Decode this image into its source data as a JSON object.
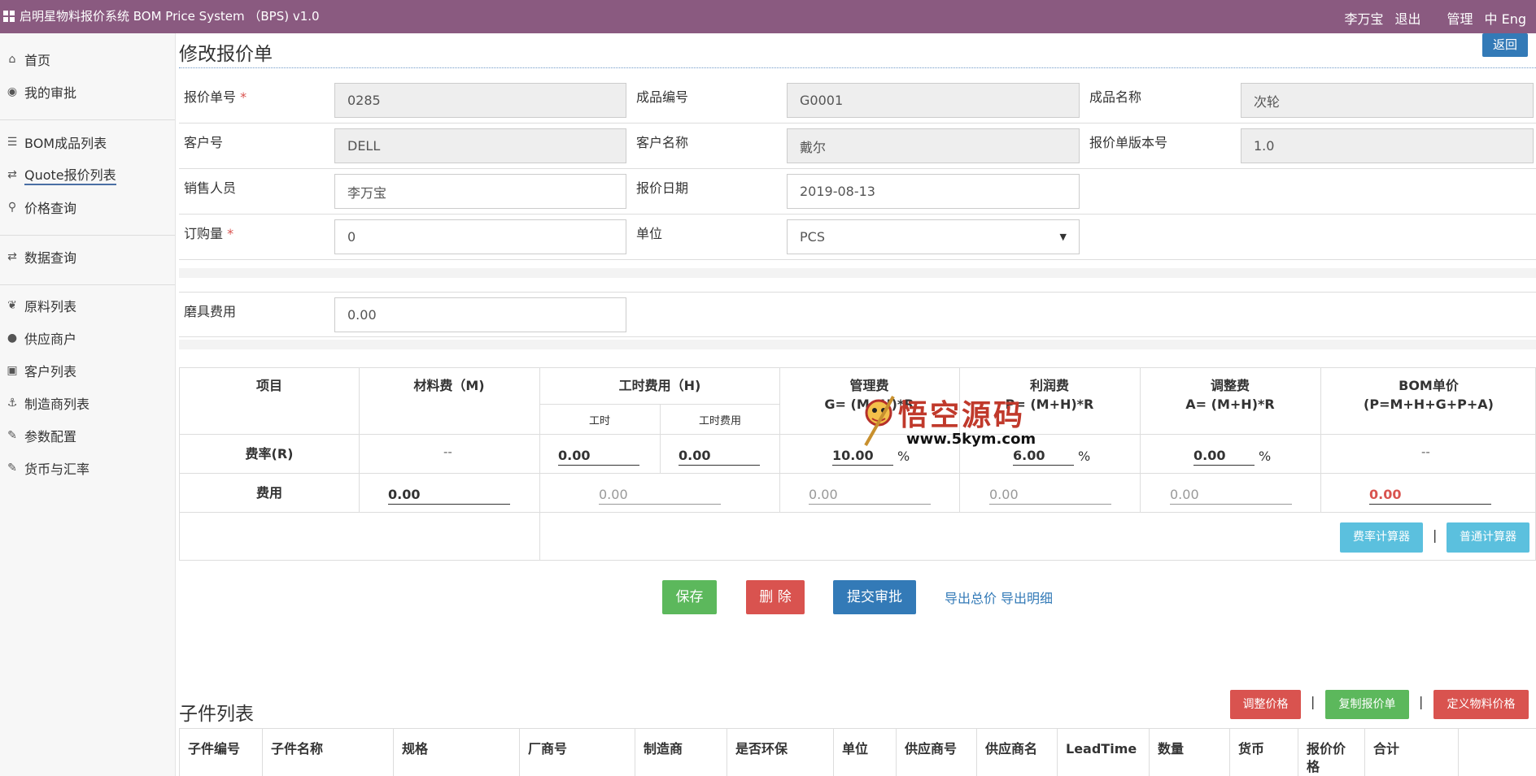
{
  "app": {
    "title": "启明星物料报价系统 BOM Price System （BPS) v1.0"
  },
  "topbar": {
    "user": "李万宝",
    "logout": "退出",
    "admin": "管理",
    "lang": "中 Eng"
  },
  "sidebar": {
    "items": [
      {
        "label": "首页",
        "icon": "home-icon"
      },
      {
        "label": "我的审批",
        "icon": "comment-icon"
      },
      {
        "label": "BOM成品列表",
        "icon": "list-icon"
      },
      {
        "label": "Quote报价列表",
        "icon": "retweet-icon"
      },
      {
        "label": "价格查询",
        "icon": "search-icon"
      },
      {
        "label": "数据查询",
        "icon": "retweet-icon"
      },
      {
        "label": "原料列表",
        "icon": "leaf-icon"
      },
      {
        "label": "供应商户",
        "icon": "user-icon"
      },
      {
        "label": "客户列表",
        "icon": "contact-icon"
      },
      {
        "label": "制造商列表",
        "icon": "anchor-icon"
      },
      {
        "label": "参数配置",
        "icon": "wrench-icon"
      },
      {
        "label": "货币与汇率",
        "icon": "wrench-icon"
      }
    ]
  },
  "page": {
    "title": "修改报价单",
    "back": "返回"
  },
  "form": {
    "quote_no": {
      "label": "报价单号",
      "value": "0285"
    },
    "product_no": {
      "label": "成品编号",
      "value": "G0001"
    },
    "product_name": {
      "label": "成品名称",
      "value": "次轮"
    },
    "customer_no": {
      "label": "客户号",
      "value": "DELL"
    },
    "customer_name": {
      "label": "客户名称",
      "value": "戴尔"
    },
    "version": {
      "label": "报价单版本号",
      "value": "1.0"
    },
    "sales": {
      "label": "销售人员",
      "value": "李万宝"
    },
    "quote_date": {
      "label": "报价日期",
      "value": "2019-08-13"
    },
    "order_qty": {
      "label": "订购量",
      "value": "0"
    },
    "unit": {
      "label": "单位",
      "value": "PCS"
    },
    "tooling": {
      "label": "磨具费用",
      "value": "0.00"
    }
  },
  "cost": {
    "headers": {
      "item": "项目",
      "material": "材料费（M)",
      "labor": "工时费用（H)",
      "labor_hours": "工时",
      "labor_fee": "工时费用",
      "mgmt_a": "管理费",
      "mgmt_b": "G= (M+H)*R",
      "profit_a": "利润费",
      "profit_b": "P= (M+H)*R",
      "adjust_a": "调整费",
      "adjust_b": "A= (M+H)*R",
      "bom_a": "BOM单价",
      "bom_b": "(P=M+H+G+P+A)"
    },
    "rate_label": "费率(R)",
    "fee_label": "费用",
    "dash": "--",
    "pct": "%",
    "rate": {
      "labor_hours": "0.00",
      "labor_fee": "0.00",
      "mgmt": "10.00",
      "profit": "6.00",
      "adjust": "0.00"
    },
    "fee": {
      "material": "0.00",
      "labor": "0.00",
      "mgmt": "0.00",
      "profit": "0.00",
      "adjust": "0.00",
      "bom": "0.00"
    },
    "rate_calc": "费率计算器",
    "normal_calc": "普通计算器",
    "sep": "|"
  },
  "actions": {
    "save": "保存",
    "delete": "删 除",
    "submit": "提交审批",
    "export_total": "导出总价",
    "export_detail": "导出明细"
  },
  "watermark": {
    "cn": "悟空源码",
    "url": "www.5kym.com"
  },
  "children": {
    "title": "子件列表",
    "adjust": "调整价格",
    "copy": "复制报价单",
    "define": "定义物料价格",
    "sep": "|",
    "columns": [
      "子件编号",
      "子件名称",
      "规格",
      "厂商号",
      "制造商",
      "是否环保",
      "单位",
      "供应商号",
      "供应商名",
      "LeadTime",
      "数量",
      "货币",
      "报价价格",
      "合计"
    ]
  },
  "colors": {
    "topbar": "#8a5a80",
    "primary": "#337ab7",
    "success": "#5cb85c",
    "danger": "#d9534f",
    "info": "#5bc0de"
  }
}
